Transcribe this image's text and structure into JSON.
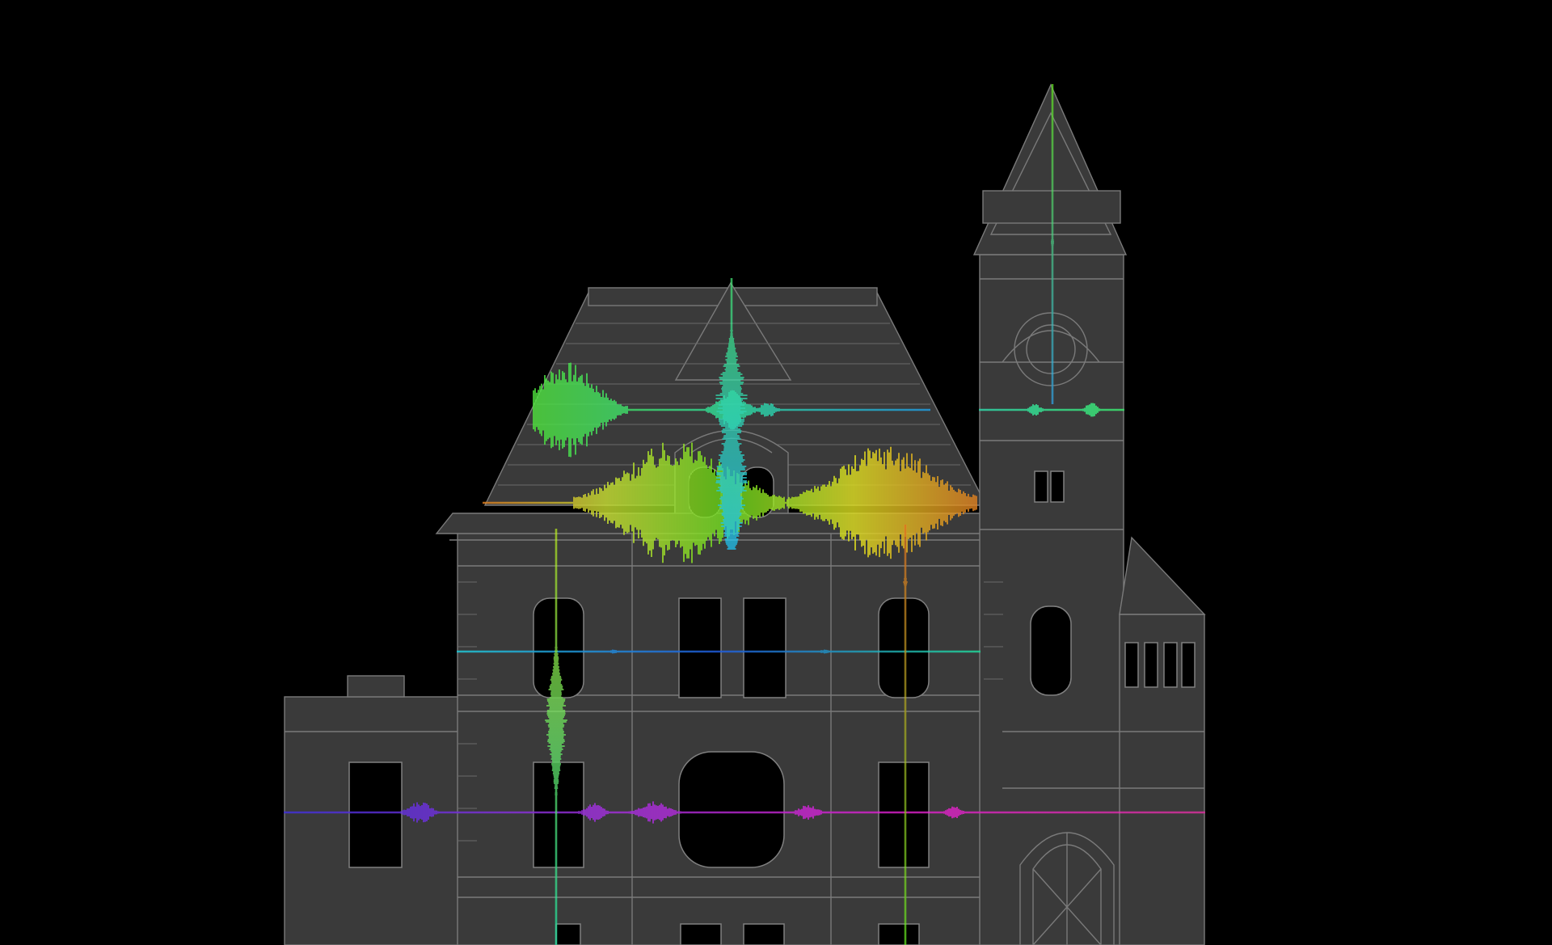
{
  "colors": {
    "background": "#000000",
    "building_fill": "#3a3a3a",
    "building_line": "#7a7a7a",
    "opening": "#000000"
  },
  "waveforms": [
    {
      "id": "roof-horizontal",
      "orientation": "horizontal",
      "colors": [
        "#4ee23c",
        "#2fe0a0",
        "#1fa0e8"
      ]
    },
    {
      "id": "tower-horizontal",
      "orientation": "horizontal",
      "colors": [
        "#2fe0b0",
        "#3cf070"
      ]
    },
    {
      "id": "eave-horizontal",
      "orientation": "horizontal",
      "colors": [
        "#e08020",
        "#c8e030",
        "#6ee020",
        "#e0e020",
        "#e08020"
      ]
    },
    {
      "id": "upper-floor-horizontal",
      "orientation": "horizontal",
      "colors": [
        "#20d0e0",
        "#2060e8",
        "#20e0a0"
      ]
    },
    {
      "id": "lower-floor-horizontal",
      "orientation": "horizontal",
      "colors": [
        "#4030e0",
        "#a030e0",
        "#e020d0",
        "#e030a0"
      ]
    },
    {
      "id": "spire-vertical",
      "orientation": "vertical",
      "colors": [
        "#40e070",
        "#20c0f0"
      ]
    },
    {
      "id": "tower-vertical",
      "orientation": "vertical",
      "colors": [
        "#60e020",
        "#30a0e0"
      ]
    },
    {
      "id": "left-vertical",
      "orientation": "vertical",
      "colors": [
        "#b0e020",
        "#20e0a0"
      ]
    },
    {
      "id": "right-vertical",
      "orientation": "vertical",
      "colors": [
        "#e07020",
        "#60e020"
      ]
    }
  ]
}
